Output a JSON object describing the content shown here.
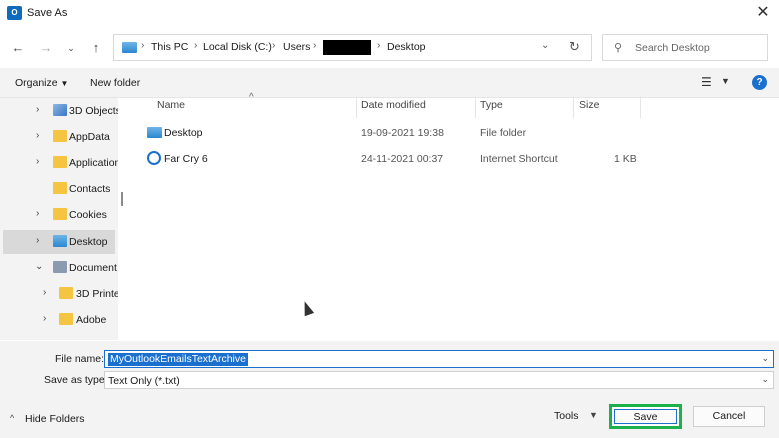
{
  "window": {
    "title": "Save As",
    "app_icon": "outlook-icon"
  },
  "address_bar": {
    "crumbs": [
      "This PC",
      "Local Disk (C:)",
      "Users",
      "Desktop"
    ]
  },
  "search": {
    "placeholder": "Search Desktop"
  },
  "toolbar": {
    "organize": "Organize",
    "new_folder": "New folder"
  },
  "nav_pane": {
    "items": [
      {
        "label": "3D Objects",
        "icon": "cube-icon"
      },
      {
        "label": "AppData",
        "icon": "folder-icon"
      },
      {
        "label": "Application",
        "icon": "folder-icon"
      },
      {
        "label": "Contacts",
        "icon": "folder-icon"
      },
      {
        "label": "Cookies",
        "icon": "folder-icon"
      },
      {
        "label": "Desktop",
        "icon": "desktop-folder-icon",
        "selected": true
      },
      {
        "label": "Document",
        "icon": "document-icon"
      },
      {
        "label": "3D Printe",
        "icon": "folder-icon"
      },
      {
        "label": "Adobe",
        "icon": "folder-icon"
      }
    ]
  },
  "file_list": {
    "columns": [
      "Name",
      "Date modified",
      "Type",
      "Size"
    ],
    "rows": [
      {
        "name": "Desktop",
        "date": "19-09-2021 19:38",
        "type": "File folder",
        "size": ""
      },
      {
        "name": "Far Cry 6",
        "date": "24-11-2021 00:37",
        "type": "Internet Shortcut",
        "size": "1 KB"
      }
    ]
  },
  "form": {
    "file_name_label": "File name:",
    "file_name_value": "MyOutlookEmailsTextArchive",
    "save_type_label": "Save as type:",
    "save_type_value": "Text Only (*.txt)"
  },
  "footer": {
    "hide_folders": "Hide Folders",
    "tools": "Tools",
    "save": "Save",
    "cancel": "Cancel"
  },
  "colors": {
    "accent": "#1a6fcf",
    "highlight": "#1cb14b"
  }
}
